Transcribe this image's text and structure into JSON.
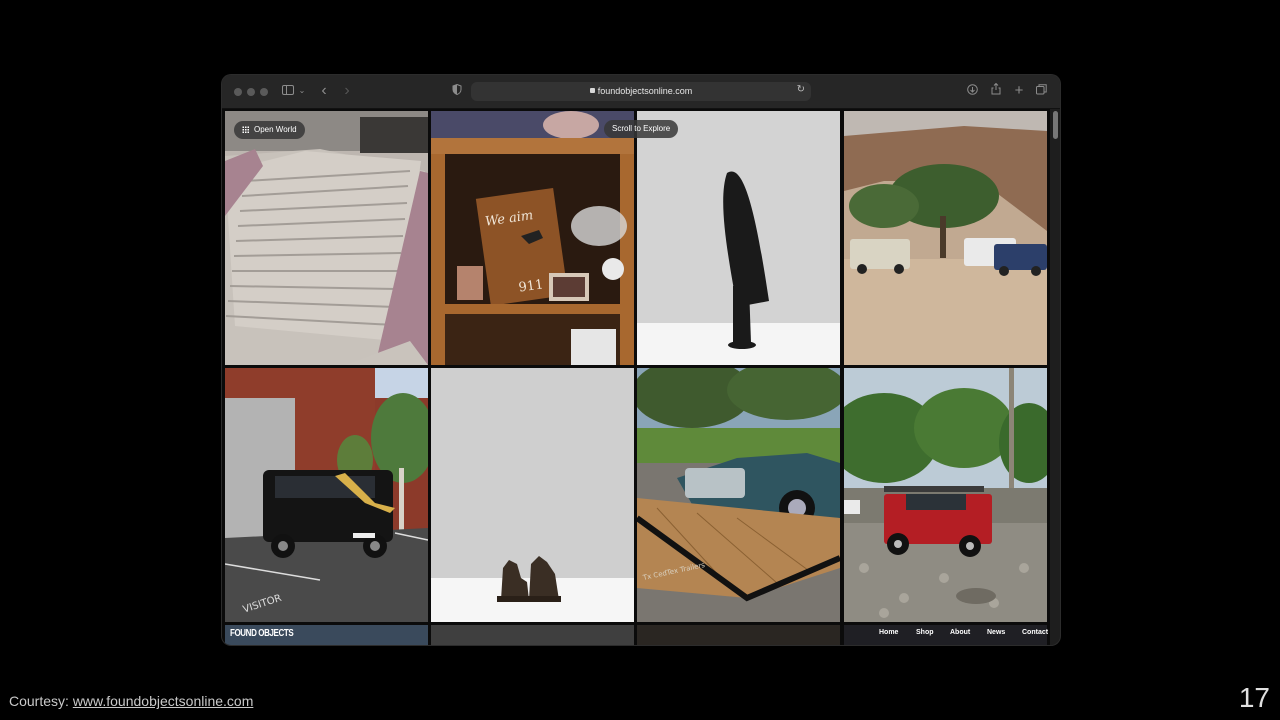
{
  "browser": {
    "url": "foundobjectsonline.com",
    "icons": [
      "sidebar-icon",
      "chevron-down-icon",
      "back-icon",
      "forward-icon",
      "shield-icon",
      "lock-icon",
      "reload-icon",
      "download-icon",
      "share-icon",
      "plus-icon",
      "tabs-icon"
    ]
  },
  "overlay": {
    "open_world": "Open World",
    "scroll_hint": "Scroll to Explore"
  },
  "grid": {
    "tiles": [
      {
        "subject": "stairs"
      },
      {
        "subject": "shelf with plaque",
        "plaque_text": "We aim to please",
        "number": "911"
      },
      {
        "subject": "black sculpture"
      },
      {
        "subject": "desert trucks"
      },
      {
        "subject": "black suv"
      },
      {
        "subject": "bookends"
      },
      {
        "subject": "vintage car on trailer"
      },
      {
        "subject": "red land rover"
      }
    ]
  },
  "site_nav": {
    "logo": "FOUND OBJECTS",
    "links": [
      "Home",
      "Shop",
      "About",
      "News",
      "Contact"
    ]
  },
  "caption": {
    "prefix": "Courtesy: ",
    "link": "www.foundobjectsonline.com"
  },
  "slide_number": "17"
}
